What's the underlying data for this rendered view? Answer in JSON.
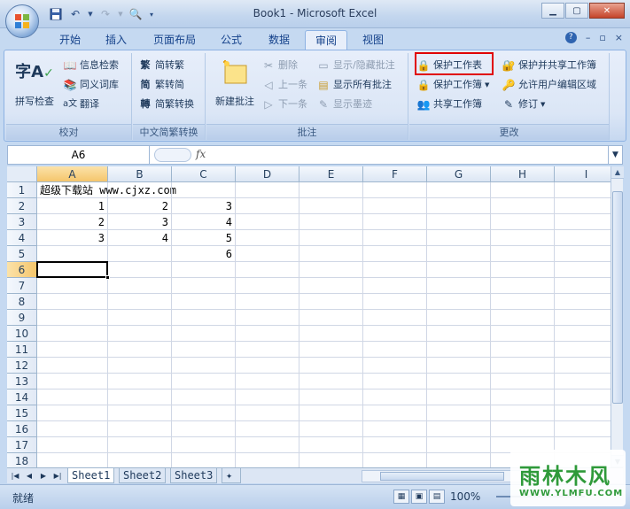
{
  "window": {
    "title": "Book1 - Microsoft Excel"
  },
  "tabs": [
    "开始",
    "插入",
    "页面布局",
    "公式",
    "数据",
    "审阅",
    "视图"
  ],
  "active_tab": "审阅",
  "ribbon": {
    "proofing": {
      "label": "校对",
      "spell_check": "拼写检查",
      "spell_icon_text": "字A",
      "research": "信息检索",
      "thesaurus": "同义词库",
      "translate": "翻译"
    },
    "chinese_conversion": {
      "label": "中文简繁转换",
      "to_traditional": "简转繁",
      "to_simplified": "繁转简",
      "convert": "简繁转换"
    },
    "comments": {
      "label": "批注",
      "new_comment": "新建批注",
      "delete": "删除",
      "previous": "上一条",
      "next": "下一条",
      "show_hide": "显示/隐藏批注",
      "show_all": "显示所有批注",
      "show_ink": "显示墨迹"
    },
    "changes": {
      "label": "更改",
      "protect_sheet": "保护工作表",
      "protect_workbook": "保护工作簿",
      "share_workbook": "共享工作簿",
      "protect_and_share": "保护并共享工作簿",
      "allow_edit_ranges": "允许用户编辑区域",
      "track_changes": "修订"
    }
  },
  "formula_bar": {
    "name_box": "A6",
    "fx": "fx",
    "formula": ""
  },
  "grid": {
    "columns": [
      "A",
      "B",
      "C",
      "D",
      "E",
      "F",
      "G",
      "H",
      "I"
    ],
    "rows": [
      "1",
      "2",
      "3",
      "4",
      "5",
      "6",
      "7",
      "8",
      "9",
      "10",
      "11",
      "12",
      "13",
      "14",
      "15",
      "16",
      "17",
      "18"
    ],
    "active_cell": "A6",
    "cells": {
      "A1": "超级下载站 www.cjxz.com",
      "A2": "1",
      "B2": "2",
      "C2": "3",
      "A3": "2",
      "B3": "3",
      "C3": "4",
      "A4": "3",
      "B4": "4",
      "C4": "5",
      "C5": "6"
    }
  },
  "sheets": [
    "Sheet1",
    "Sheet2",
    "Sheet3"
  ],
  "active_sheet": "Sheet1",
  "status": {
    "ready": "就绪",
    "zoom": "100%"
  },
  "watermark": {
    "brand": "雨林木风",
    "url": "WWW.YLMFU.COM"
  },
  "colors": {
    "highlight_border": "#e00000",
    "selected_header": "#f5c66c"
  }
}
